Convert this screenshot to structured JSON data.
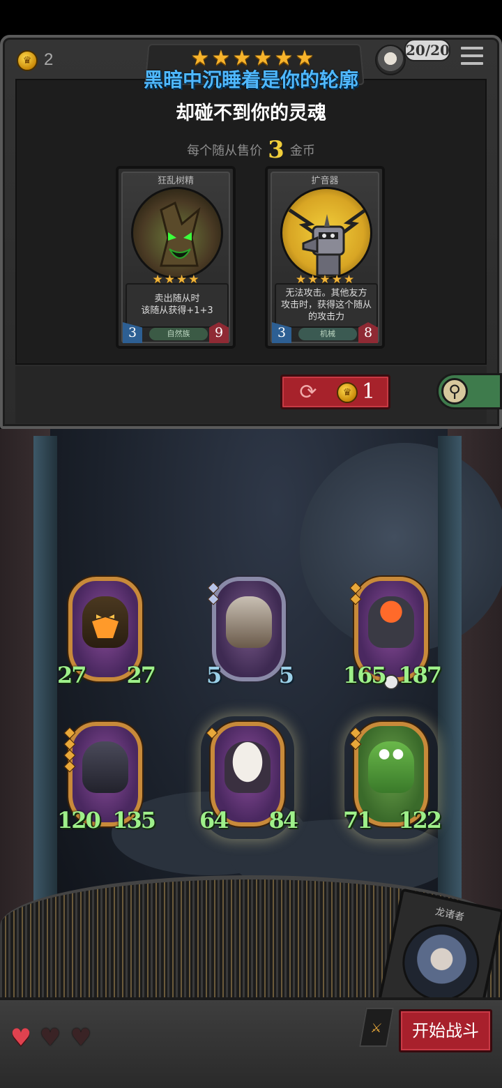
{
  "top_bar": {
    "gold_count": "2",
    "turn_counter": "20/20",
    "star_count": 6
  },
  "shop": {
    "title_line1": "黑暗中沉睡着是你的轮廓",
    "title_line2": "却碰不到你的灵魂",
    "price_prefix": "每个随从售价",
    "price_value": "3",
    "price_suffix": "金币",
    "cards": [
      {
        "name": "狂乱树精",
        "stars": 4,
        "description": "卖出随从时\n该随从获得+1+3",
        "attack": "3",
        "health": "9",
        "tribe": "自然族"
      },
      {
        "name": "扩音器",
        "stars": 5,
        "description": "无法攻击。其他友方\n攻击时，获得这个随从\n的攻击力",
        "attack": "3",
        "health": "8",
        "tribe": "机械"
      }
    ],
    "refresh_cost": "1"
  },
  "board": {
    "minions": [
      {
        "attack": "27",
        "health": "27",
        "frame": "gold",
        "stars": 0
      },
      {
        "attack": "5",
        "health": "5",
        "frame": "silver",
        "stars": 2
      },
      {
        "attack": "165",
        "health": "187",
        "frame": "gold",
        "stars": 2
      },
      {
        "attack": "120",
        "health": "135",
        "frame": "gold",
        "stars": 4
      },
      {
        "attack": "64",
        "health": "84",
        "frame": "gold",
        "stars": 1
      },
      {
        "attack": "71",
        "health": "122",
        "frame": "gold",
        "stars": 2
      }
    ]
  },
  "hero": {
    "name": "龙诸者"
  },
  "lives": {
    "total": 3,
    "remaining": 1
  },
  "actions": {
    "start_battle": "开始战斗"
  },
  "colors": {
    "title_blue": "#4fb8ff",
    "button_red": "#a8202c",
    "stat_green": "#9ef08a",
    "gold": "#f2cf3b"
  }
}
